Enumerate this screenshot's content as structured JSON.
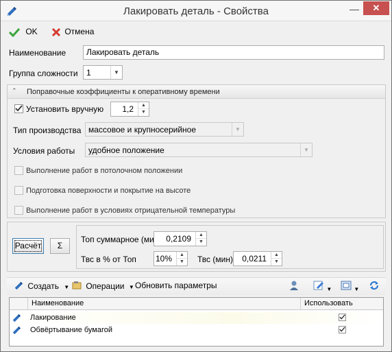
{
  "window": {
    "title": "Лакировать деталь - Свойства",
    "close_glyph": "✕",
    "minimize_glyph": "—"
  },
  "toolbar": {
    "ok_label": "OK",
    "cancel_label": "Отмена"
  },
  "fields": {
    "name_label": "Наименование",
    "name_value": "Лакировать деталь",
    "complexity_label": "Группа сложности",
    "complexity_value": "1"
  },
  "coefficients": {
    "title": "Поправочные коэффициенты к оперативному времени",
    "manual_label": "Установить вручную",
    "manual_checked": true,
    "manual_value": "1,2",
    "production_type_label": "Тип производства",
    "production_type_value": "массовое и крупносерийное",
    "work_conditions_label": "Условия работы",
    "work_conditions_value": "удобное положение",
    "options": [
      {
        "label": "Выполнение работ в потолочном положении",
        "checked": false
      },
      {
        "label": "Подготовка поверхности и покрытие на высоте",
        "checked": false
      },
      {
        "label": "Выполнение работ в условиях отрицательной температуры",
        "checked": false
      }
    ]
  },
  "calc": {
    "calc_button": "Расчёт",
    "sum_button": "Σ",
    "top_total_label": "Топ суммарное (мин)",
    "top_total_value": "0,2109",
    "tvs_percent_label": "Твс в % от Топ",
    "tvs_percent_value": "10%",
    "tvs_min_label": "Твс (мин)",
    "tvs_min_value": "0,0211"
  },
  "list_toolbar": {
    "create_label": "Создать",
    "operations_label": "Операции",
    "update_label": "Обновить параметры"
  },
  "grid": {
    "columns": [
      "Наименование",
      "Использовать"
    ],
    "rows": [
      {
        "name": "Лакирование",
        "use": true
      },
      {
        "name": "Обвёртывание бумагой",
        "use": true
      }
    ]
  },
  "colors": {
    "ok_green": "#3aa53a",
    "cancel_red": "#d33a2f",
    "close_red": "#c75050"
  }
}
